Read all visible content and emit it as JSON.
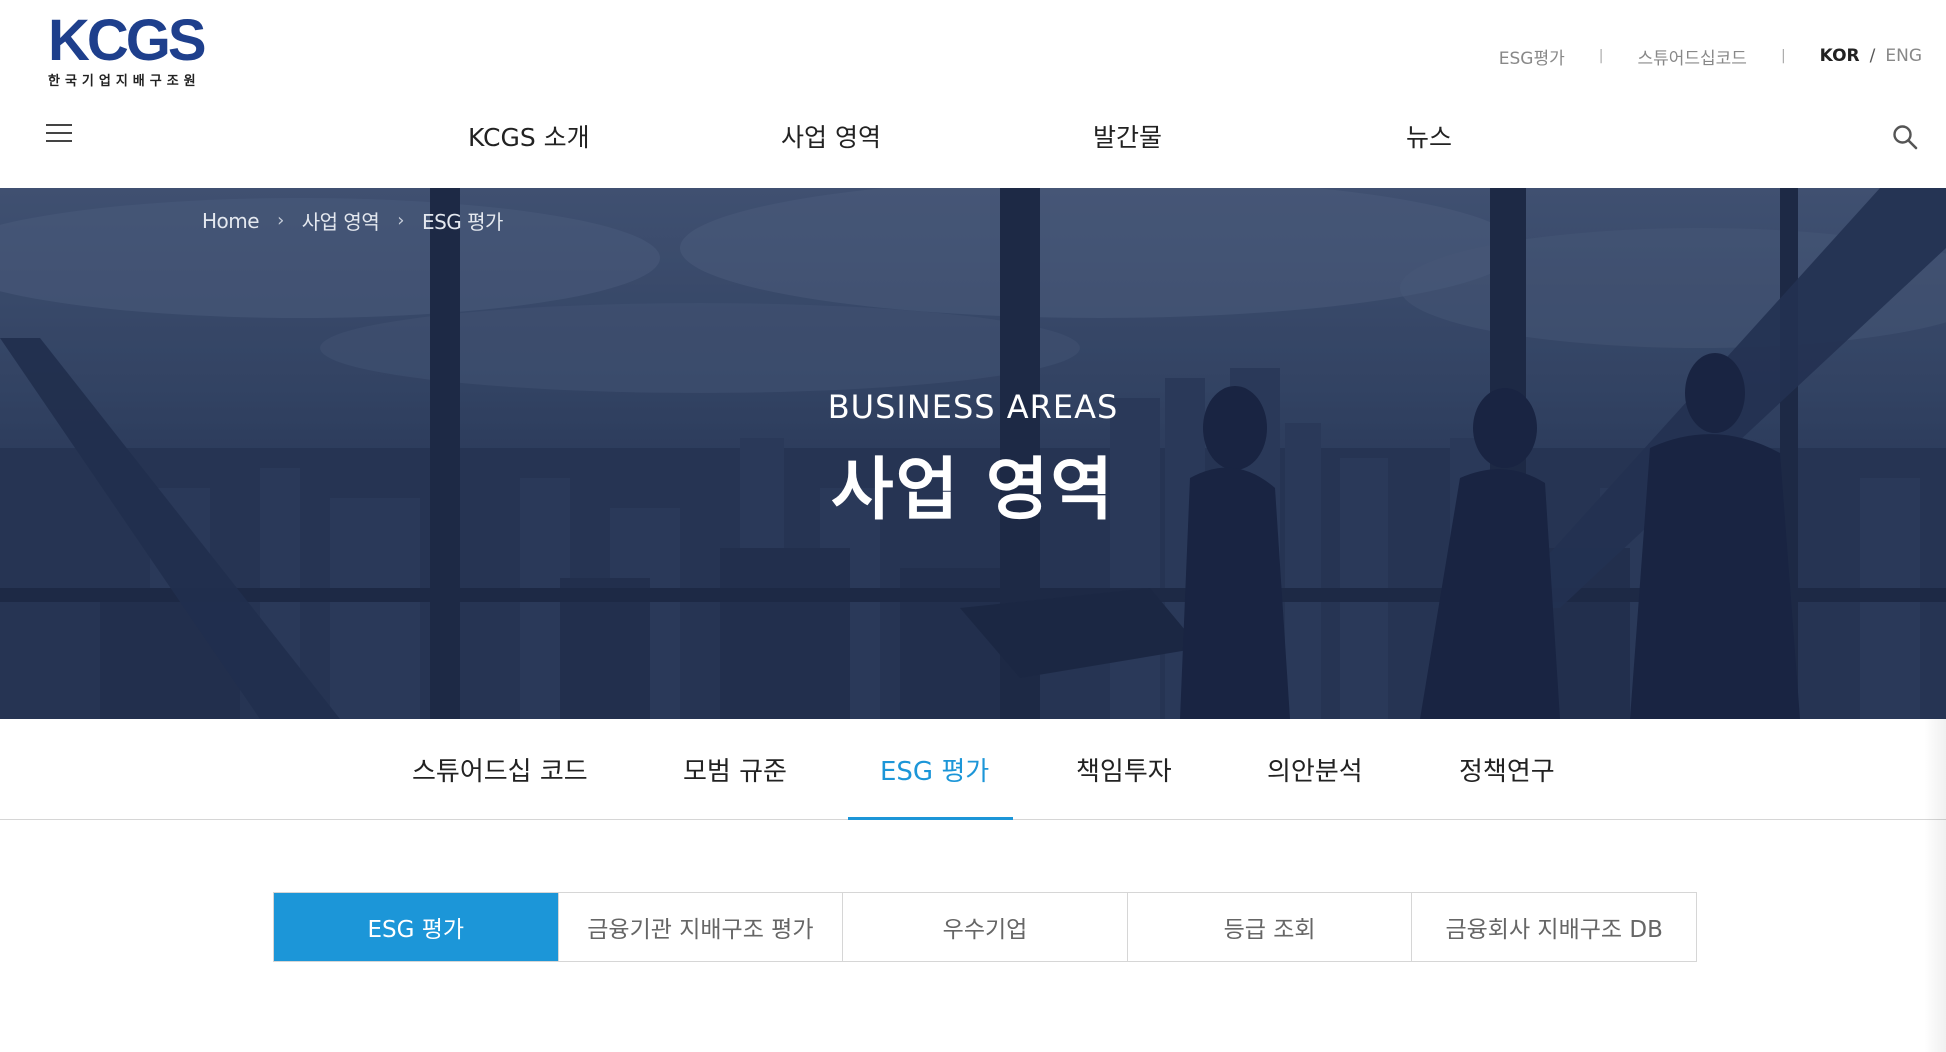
{
  "header": {
    "logo": {
      "mark": "KCGS",
      "sub": "한국기업지배구조원"
    },
    "util": {
      "link1": "ESG평가",
      "link2": "스튜어드십코드",
      "lang_kor": "KOR",
      "lang_slash": "/",
      "lang_eng": "ENG"
    },
    "gnb": [
      "KCGS 소개",
      "사업 영역",
      "발간물",
      "뉴스"
    ]
  },
  "hero": {
    "breadcrumb": [
      "Home",
      "사업 영역",
      "ESG 평가"
    ],
    "title_en": "BUSINESS AREAS",
    "title_ko": "사업 영역"
  },
  "subnav": [
    "스튜어드십 코드",
    "모범 규준",
    "ESG 평가",
    "책임투자",
    "의안분석",
    "정책연구"
  ],
  "subnav_active": "ESG 평가",
  "tabs": [
    "ESG 평가",
    "금융기관 지배구조 평가",
    "우수기업",
    "등급 조회",
    "금융회사 지배구조 DB"
  ],
  "tabs_active": "ESG 평가",
  "colors": {
    "brand": "#1e3f8c",
    "accent": "#1c96d8",
    "hero_overlay": "#2b3b5b"
  }
}
